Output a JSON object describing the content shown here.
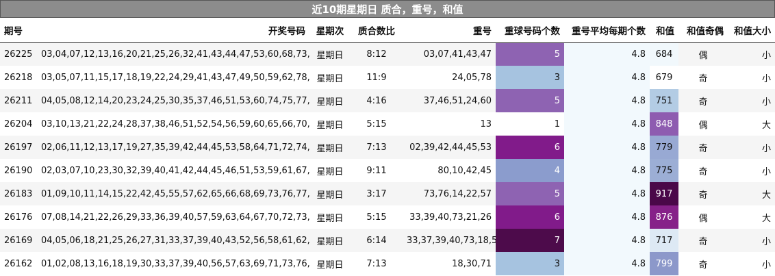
{
  "title": "近10期星期日 质合，重号，和值",
  "headers": [
    "期号",
    "开奖号码",
    "星期次",
    "质合数比",
    "重号",
    "重球号码个数",
    "重号平均每期个数",
    "和值",
    "和值奇偶",
    "和值大小"
  ],
  "rows": [
    {
      "issue": "26225",
      "numbers": "03,04,07,12,13,16,20,21,25,26,32,41,43,44,47,53,60,68,73,76",
      "weekday": "星期日",
      "ratio": "8:12",
      "repeat": "03,07,41,43,47",
      "count": "5",
      "avg": "4.8",
      "sum": "684",
      "parity": "偶",
      "size": "小",
      "count_bg": "#8e63b2",
      "count_fg": "#ffffff",
      "sum_bg": "#f1f8fc",
      "sum_fg": "#111111"
    },
    {
      "issue": "26218",
      "numbers": "03,05,07,11,15,17,18,19,22,24,29,41,43,47,49,50,59,62,78,80",
      "weekday": "星期日",
      "ratio": "11:9",
      "repeat": "24,05,78",
      "count": "3",
      "avg": "4.8",
      "sum": "679",
      "parity": "奇",
      "size": "小",
      "count_bg": "#a6c3e0",
      "count_fg": "#111111",
      "sum_bg": "#ffffff",
      "sum_fg": "#111111"
    },
    {
      "issue": "26211",
      "numbers": "04,05,08,12,14,20,23,24,25,30,35,37,46,51,53,60,74,75,77,78",
      "weekday": "星期日",
      "ratio": "4:16",
      "repeat": "37,46,51,24,60",
      "count": "5",
      "avg": "4.8",
      "sum": "751",
      "parity": "奇",
      "size": "小",
      "count_bg": "#8e63b2",
      "count_fg": "#ffffff",
      "sum_bg": "#b3cce4",
      "sum_fg": "#111111"
    },
    {
      "issue": "26204",
      "numbers": "03,10,13,21,22,24,28,37,38,46,51,52,54,56,59,60,65,66,70,73",
      "weekday": "星期日",
      "ratio": "5:15",
      "repeat": "13",
      "count": "1",
      "avg": "4.8",
      "sum": "848",
      "parity": "偶",
      "size": "大",
      "count_bg": "#ffffff",
      "count_fg": "#111111",
      "sum_bg": "#8e5cb0",
      "sum_fg": "#ffffff"
    },
    {
      "issue": "26197",
      "numbers": "02,06,11,12,13,17,19,27,35,39,42,44,45,53,58,64,71,72,74,75",
      "weekday": "星期日",
      "ratio": "7:13",
      "repeat": "02,39,42,44,45,53",
      "count": "6",
      "avg": "4.8",
      "sum": "779",
      "parity": "奇",
      "size": "小",
      "count_bg": "#811b8a",
      "count_fg": "#ffffff",
      "sum_bg": "#98a9d3",
      "sum_fg": "#111111"
    },
    {
      "issue": "26190",
      "numbers": "02,03,07,10,23,30,32,39,40,41,42,44,45,46,51,53,59,61,67,80",
      "weekday": "星期日",
      "ratio": "9:11",
      "repeat": "80,10,42,45",
      "count": "4",
      "avg": "4.8",
      "sum": "775",
      "parity": "奇",
      "size": "小",
      "count_bg": "#8b9ccd",
      "count_fg": "#ffffff",
      "sum_bg": "#9caed5",
      "sum_fg": "#111111"
    },
    {
      "issue": "26183",
      "numbers": "01,09,10,11,14,15,22,42,45,55,57,62,65,66,68,69,73,76,77,80",
      "weekday": "星期日",
      "ratio": "3:17",
      "repeat": "73,76,14,22,57",
      "count": "5",
      "avg": "4.8",
      "sum": "917",
      "parity": "奇",
      "size": "大",
      "count_bg": "#8e63b2",
      "count_fg": "#ffffff",
      "sum_bg": "#4a0849",
      "sum_fg": "#ffffff"
    },
    {
      "issue": "26176",
      "numbers": "07,08,14,21,22,26,29,33,36,39,40,57,59,63,64,67,70,72,73,76",
      "weekday": "星期日",
      "ratio": "5:15",
      "repeat": "33,39,40,73,21,26",
      "count": "6",
      "avg": "4.8",
      "sum": "876",
      "parity": "偶",
      "size": "大",
      "count_bg": "#811b8a",
      "count_fg": "#ffffff",
      "sum_bg": "#862189",
      "sum_fg": "#ffffff"
    },
    {
      "issue": "26169",
      "numbers": "04,05,06,18,21,25,26,27,31,33,37,39,40,43,52,56,58,61,62,73",
      "weekday": "星期日",
      "ratio": "6:14",
      "repeat": "33,37,39,40,73,18,56",
      "count": "7",
      "avg": "4.8",
      "sum": "717",
      "parity": "奇",
      "size": "小",
      "count_bg": "#4d0b4b",
      "count_fg": "#ffffff",
      "sum_bg": "#dde9f4",
      "sum_fg": "#111111"
    },
    {
      "issue": "26162",
      "numbers": "01,02,08,13,16,18,19,30,33,37,39,40,56,57,63,69,71,73,76,78",
      "weekday": "星期日",
      "ratio": "7:13",
      "repeat": "18,30,71",
      "count": "3",
      "avg": "4.8",
      "sum": "799",
      "parity": "奇",
      "size": "小",
      "count_bg": "#a6c3e0",
      "count_fg": "#111111",
      "sum_bg": "#8c98ca",
      "sum_fg": "#ffffff"
    }
  ]
}
